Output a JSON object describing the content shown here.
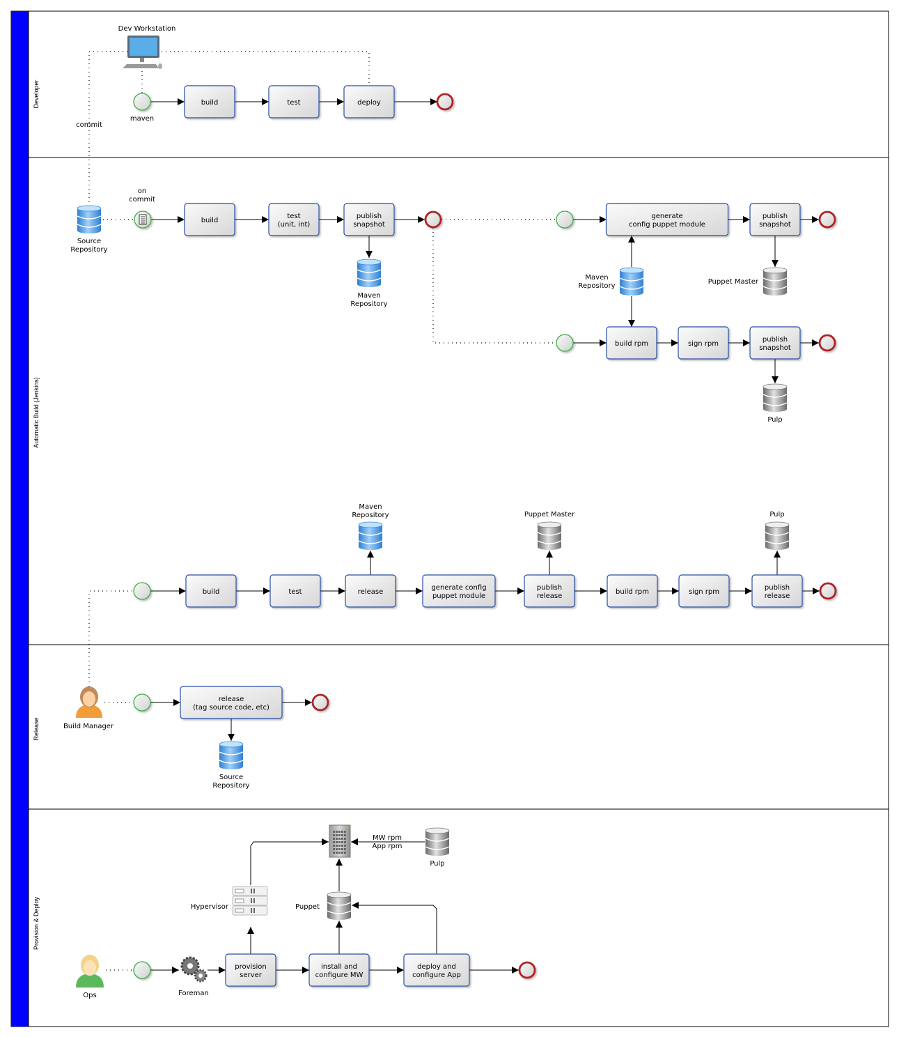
{
  "lanes": [
    {
      "id": "developer",
      "label": "Developer"
    },
    {
      "id": "auto",
      "label": "Automatic Build (Jenkins)"
    },
    {
      "id": "release",
      "label": "Release"
    },
    {
      "id": "provision",
      "label": "Provision & Deploy"
    }
  ],
  "colors": {
    "lane_header": "#0000ff",
    "task_border": "#2b4ea3",
    "start_event": "#3cb043",
    "end_event": "#b22222",
    "db_blue": "#4a9be0",
    "db_gray": "#8a8a8a"
  },
  "tasks": {
    "dev_build": "build",
    "dev_test": "test",
    "dev_deploy": "deploy",
    "ci_build": "build",
    "ci_test": [
      "test",
      "(unit, int)"
    ],
    "ci_publish_snapshot": [
      "publish",
      "snapshot"
    ],
    "gen_puppet": [
      "generate",
      "config puppet module"
    ],
    "pup_publish_snapshot": [
      "publish",
      "snapshot"
    ],
    "build_rpm": "build rpm",
    "sign_rpm": "sign rpm",
    "rpm_publish_snapshot": [
      "publish",
      "snapshot"
    ],
    "rel_build": "build",
    "rel_test": "test",
    "rel_release": "release",
    "rel_gen_puppet": [
      "generate config",
      "puppet module"
    ],
    "rel_publish_release1": [
      "publish",
      "release"
    ],
    "rel_build_rpm": "build rpm",
    "rel_sign_rpm": "sign rpm",
    "rel_publish_release2": [
      "publish",
      "release"
    ],
    "tag_release": [
      "release",
      "(tag source code, etc)"
    ],
    "provision_server": [
      "provision",
      "server"
    ],
    "install_mw": [
      "install and",
      "configure MW"
    ],
    "deploy_app": [
      "deploy and",
      "configure App"
    ]
  },
  "labels": {
    "dev_workstation": "Dev Workstation",
    "maven": "maven",
    "commit": "commit",
    "on_commit": [
      "on",
      "commit"
    ],
    "source_repo": [
      "Source",
      "Repository"
    ],
    "maven_repo_1": [
      "Maven",
      "Repository"
    ],
    "maven_repo_2": [
      "Maven",
      "Repository"
    ],
    "puppet_master_1": "Puppet Master",
    "pulp_1": "Pulp",
    "maven_repo_3": [
      "Maven",
      "Repository"
    ],
    "puppet_master_2": "Puppet Master",
    "pulp_2": "Pulp",
    "build_manager": "Build Manager",
    "source_repo_2": [
      "Source",
      "Repository"
    ],
    "hypervisor": "Hypervisor",
    "puppet": "Puppet",
    "mw_rpm": [
      "MW rpm",
      "App rpm"
    ],
    "pulp_3": "Pulp",
    "ops": "Ops",
    "foreman": "Foreman"
  }
}
